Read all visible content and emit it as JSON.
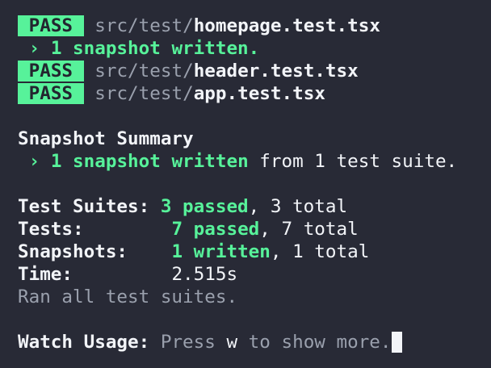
{
  "results": [
    {
      "status": "PASS",
      "dir": "src/test/",
      "file": "homepage.test.tsx"
    },
    {
      "status": "PASS",
      "dir": "src/test/",
      "file": "header.test.tsx"
    },
    {
      "status": "PASS",
      "dir": "src/test/",
      "file": "app.test.tsx"
    }
  ],
  "homepage_note": "› 1 snapshot written.",
  "snapshot_summary": {
    "title": "Snapshot Summary",
    "arrow": "›",
    "highlight": "1 snapshot written",
    "rest": "from 1 test suite."
  },
  "stats": {
    "suites_label": "Test Suites:",
    "suites_passed": "3 passed",
    "suites_total": ", 3 total",
    "tests_label": "Tests:",
    "tests_passed": "7 passed",
    "tests_total": ", 7 total",
    "snapshots_label": "Snapshots:",
    "snapshots_written": "1 written",
    "snapshots_total": ", 1 total",
    "time_label": "Time:",
    "time_value": "2.515s"
  },
  "ran_all": "Ran all test suites.",
  "watch": {
    "label": "Watch Usage:",
    "prefix": "Press ",
    "key": "w",
    "suffix": " to show more."
  },
  "colors": {
    "background": "#282a36",
    "pass_green": "#57f29a",
    "dim_text": "#9aa0ad",
    "text": "#f2f4f8"
  }
}
